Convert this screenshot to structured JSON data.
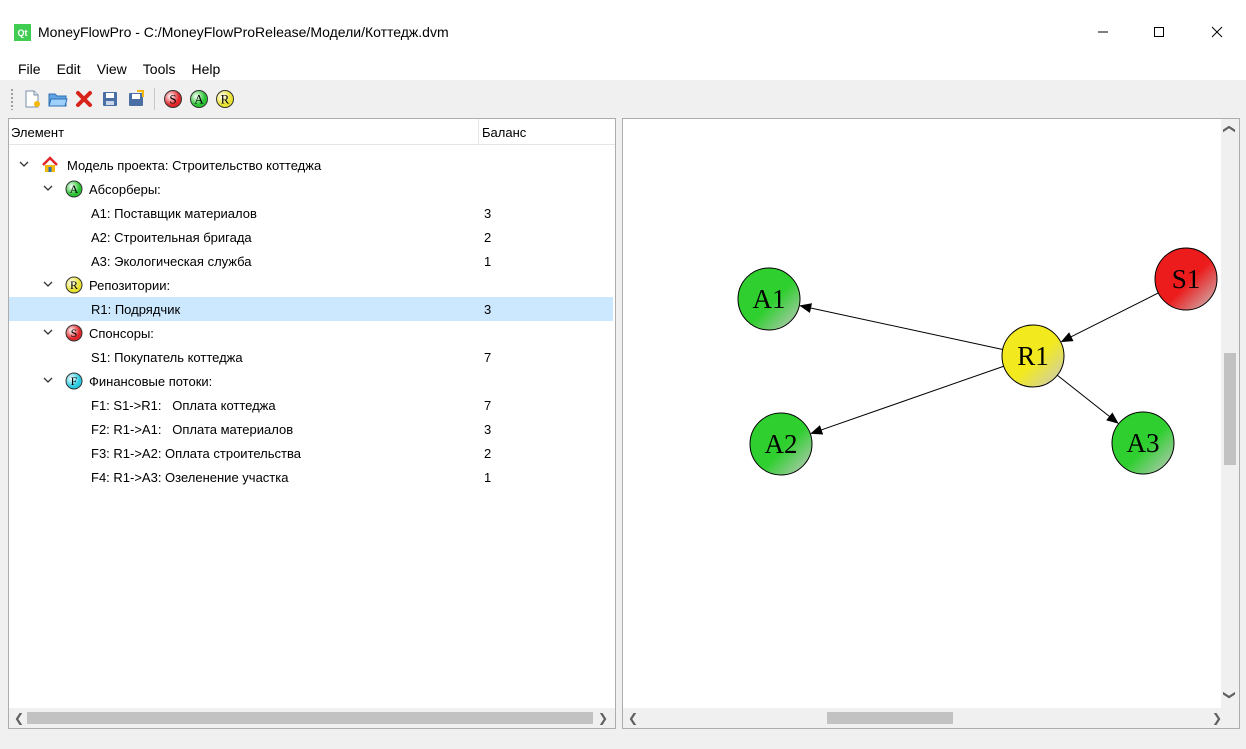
{
  "window": {
    "title": "MoneyFlowPro - C:/MoneyFlowProRelease/Модели/Коттедж.dvm",
    "app_icon_text": "Qt"
  },
  "menu": [
    "File",
    "Edit",
    "View",
    "Tools",
    "Help"
  ],
  "toolbar": {
    "buttons": [
      "new-file-icon",
      "open-folder-icon",
      "delete-icon",
      "save-icon",
      "save-as-icon"
    ],
    "add_buttons": [
      {
        "name": "add-sponsor-icon",
        "letter": "S",
        "color": "#e0262a"
      },
      {
        "name": "add-absorber-icon",
        "letter": "A",
        "color": "#29c431"
      },
      {
        "name": "add-repository-icon",
        "letter": "R",
        "color": "#e9e22f"
      }
    ]
  },
  "tree": {
    "header": {
      "element": "Элемент",
      "balance": "Баланс"
    },
    "root": "Модель проекта: Строительство коттеджа",
    "groups": [
      {
        "label": "Абсорберы:",
        "letter": "A",
        "color": "#29c431",
        "items": [
          {
            "label": "A1: Поставщик материалов",
            "value": "3"
          },
          {
            "label": "A2: Строительная бригада",
            "value": "2"
          },
          {
            "label": "A3: Экологическая служба",
            "value": "1"
          }
        ]
      },
      {
        "label": "Репозитории:",
        "letter": "R",
        "color": "#e9e22f",
        "items": [
          {
            "label": "R1: Подрядчик",
            "value": "3",
            "selected": true
          }
        ]
      },
      {
        "label": "Спонсоры:",
        "letter": "S",
        "color": "#e0262a",
        "items": [
          {
            "label": "S1: Покупатель коттеджа",
            "value": "7"
          }
        ]
      },
      {
        "label": "Финансовые потоки:",
        "letter": "F",
        "color": "#29c9e0",
        "items": [
          {
            "label": "F1: S1->R1:   Оплата коттеджа",
            "value": "7"
          },
          {
            "label": "F2: R1->A1:   Оплата материалов",
            "value": "3"
          },
          {
            "label": "F3: R1->A2: Оплата строительства",
            "value": "2"
          },
          {
            "label": "F4: R1->A3: Озеленение участка",
            "value": "1"
          }
        ]
      }
    ]
  },
  "graph": {
    "nodes": [
      {
        "id": "A1",
        "label": "A1",
        "color": "#2ecf2e"
      },
      {
        "id": "A2",
        "label": "A2",
        "color": "#2ecf2e"
      },
      {
        "id": "A3",
        "label": "A3",
        "color": "#2ecf2e"
      },
      {
        "id": "R1",
        "label": "R1",
        "color": "#f2ea1e"
      },
      {
        "id": "S1",
        "label": "S1",
        "color": "#ec1c1c"
      }
    ],
    "edges": [
      {
        "from": "S1",
        "to": "R1"
      },
      {
        "from": "R1",
        "to": "A1"
      },
      {
        "from": "R1",
        "to": "A2"
      },
      {
        "from": "R1",
        "to": "A3"
      }
    ]
  }
}
